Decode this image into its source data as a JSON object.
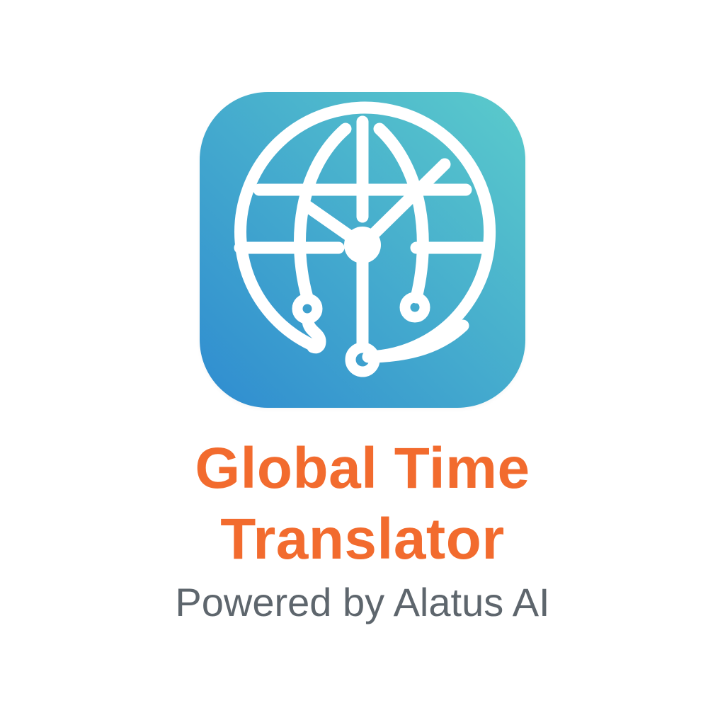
{
  "logo": {
    "icon": "globe-clock-icon",
    "gradient_start": "#2F8CD0",
    "gradient_end": "#5BCBCB",
    "stroke_color": "#FFFFFF"
  },
  "title": {
    "line1": "Global Time",
    "line2": "Translator",
    "color": "#F26B2E"
  },
  "subtitle": {
    "text": "Powered by Alatus AI",
    "color": "#5E666D"
  }
}
